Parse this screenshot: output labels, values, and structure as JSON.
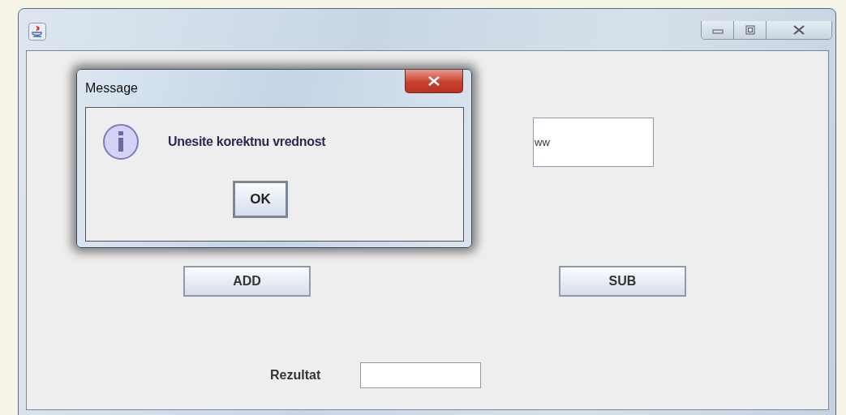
{
  "form": {
    "input_value": "ww",
    "buttons": [
      {
        "label": "ADD"
      },
      {
        "label": "SUB"
      }
    ],
    "result_label": "Rezultat"
  },
  "dialog": {
    "title": "Message",
    "message": "Unesite korektnu vrednost",
    "button": "OK"
  }
}
